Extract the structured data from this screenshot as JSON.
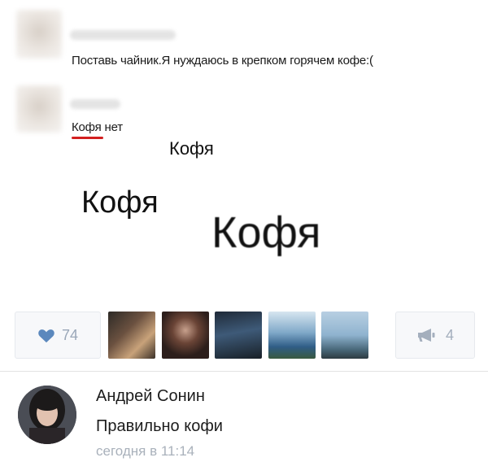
{
  "post": {
    "message1": "Поставь чайник.Я нуждаюсь в крепком горячем кофе:(",
    "message2_word": "Кофя",
    "message2_rest": " нет",
    "kofya_small": "Кофя",
    "kofya_medium": "Кофя",
    "kofya_large": "Кофя"
  },
  "actions": {
    "likes_count": "74",
    "shares_count": "4",
    "like_icon": "heart-icon",
    "share_icon": "megaphone-icon"
  },
  "comment": {
    "author": "Андрей Сонин",
    "text": "Правильно кофи",
    "time": "сегодня в 11:14"
  },
  "colors": {
    "accent": "#5b88bd",
    "muted_icon": "#9aa7b8",
    "underline": "#d32020"
  }
}
